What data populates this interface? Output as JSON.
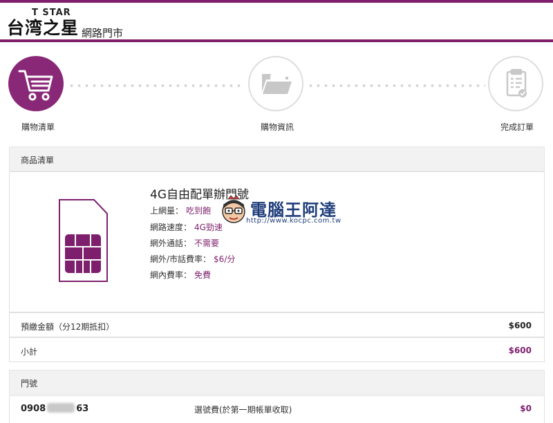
{
  "header": {
    "logo_en": "T STAR",
    "logo_zh": "台湾之星",
    "subtitle": "網路門市"
  },
  "steps": [
    {
      "label": "購物清單",
      "icon": "cart-icon",
      "active": true
    },
    {
      "label": "購物資訊",
      "icon": "folder-icon",
      "active": false
    },
    {
      "label": "完成訂單",
      "icon": "clipboard-check-icon",
      "active": false
    }
  ],
  "product_section": {
    "title": "商品清單"
  },
  "product": {
    "name": "4G自由配單辦門號",
    "icon": "sim-card-icon",
    "specs": [
      {
        "label": "上網量：",
        "value": "吃到飽"
      },
      {
        "label": "網路速度：",
        "value": "4G勁速"
      },
      {
        "label": "網外通話：",
        "value": "不需要"
      },
      {
        "label": "網外/市話費率：",
        "value": "$6/分"
      },
      {
        "label": "網內費率：",
        "value": "免費"
      }
    ]
  },
  "summary": {
    "prepay_label": "預繳金額（分12期抵扣）",
    "prepay_amount": "$600",
    "subtotal_label": "小計",
    "subtotal_amount": "$600"
  },
  "number_section": {
    "title": "門號",
    "number_prefix": "0908",
    "number_suffix": "63",
    "fee_label": "選號費(於第一期帳單收取)",
    "fee_amount": "$0"
  },
  "watermark": {
    "text": "電腦王阿達",
    "url": "http://www.kocpc.com.tw"
  },
  "colors": {
    "brand": "#7e1f6d",
    "active_step": "#8a2878",
    "section_bg": "#f2f2f2"
  }
}
